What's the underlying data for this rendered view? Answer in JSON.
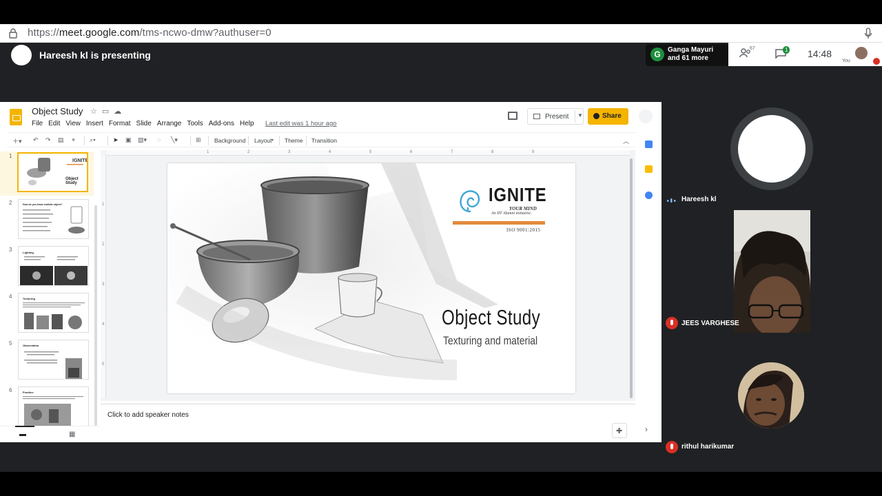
{
  "browser": {
    "url_prefix": "https://",
    "url_host": "meet.google.com",
    "url_path": "/tms-ncwo-dmw?authuser=0"
  },
  "meet": {
    "presenting_text": "Hareesh kl is presenting",
    "chip_initial": "G",
    "chip_name_line1": "Ganga Mayuri",
    "chip_name_line2": "and 61 more",
    "people_count": "67",
    "chat_badge": "1",
    "clock": "14:48",
    "you_label": "You"
  },
  "slides_app": {
    "doc_title": "Object Study",
    "menu": [
      "File",
      "Edit",
      "View",
      "Insert",
      "Format",
      "Slide",
      "Arrange",
      "Tools",
      "Add-ons",
      "Help"
    ],
    "last_edit": "Last edit was 1 hour ago",
    "present_label": "Present",
    "share_label": "Share",
    "toolbar": {
      "background": "Background",
      "layout": "Layout",
      "theme": "Theme",
      "transition": "Transition"
    },
    "slide_numbers": [
      "1",
      "2",
      "3",
      "4",
      "5",
      "6"
    ],
    "thumb_labels": [
      "Object Study",
      "How do you know realistic object?",
      "Lighting",
      "Texturing",
      "Observation",
      "Practice"
    ],
    "ruler_top": [
      "1",
      "2",
      "3",
      "4",
      "5",
      "6",
      "7",
      "8",
      "9"
    ],
    "ruler_left": [
      "1",
      "2",
      "3",
      "4",
      "5"
    ],
    "notes_placeholder": "Click to add speaker notes"
  },
  "slide": {
    "logo_word": "IGNITE",
    "logo_tag": "YOUR MIND",
    "logo_tag2": "An IIT Alumni initiative.",
    "logo_iso": "ISO 9001:2015",
    "title": "Object Study",
    "subtitle": "Texturing and material"
  },
  "participants": [
    {
      "name": "Hareesh kl"
    },
    {
      "name": "JEES VARGHESE"
    },
    {
      "name": "rithul harikumar"
    }
  ],
  "colors": {
    "meet_bg": "#202124",
    "slides_yellow": "#f4b400",
    "logo_orange": "#e28a3b",
    "mic_off_red": "#d93025"
  }
}
